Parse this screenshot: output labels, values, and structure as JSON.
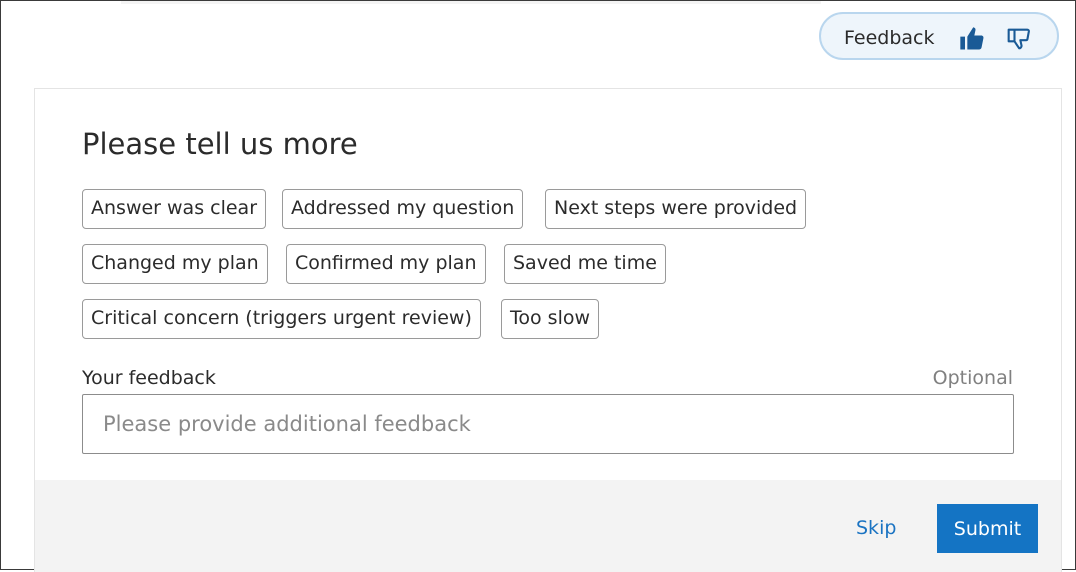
{
  "feedback_pill": {
    "label": "Feedback",
    "thumbs_up_icon": "thumbs-up-filled",
    "thumbs_down_icon": "thumbs-down-outline",
    "accent": "#1474c4"
  },
  "panel": {
    "title": "Please tell us more",
    "chips": [
      "Answer was clear",
      "Addressed my question",
      "Next steps were provided",
      "Changed my plan",
      "Confirmed my plan",
      "Saved me time",
      "Critical concern (triggers urgent review)",
      "Too slow"
    ],
    "field_label": "Your feedback",
    "optional_label": "Optional",
    "input_value": "",
    "input_placeholder": "Please provide additional feedback",
    "skip_label": "Skip",
    "submit_label": "Submit"
  }
}
